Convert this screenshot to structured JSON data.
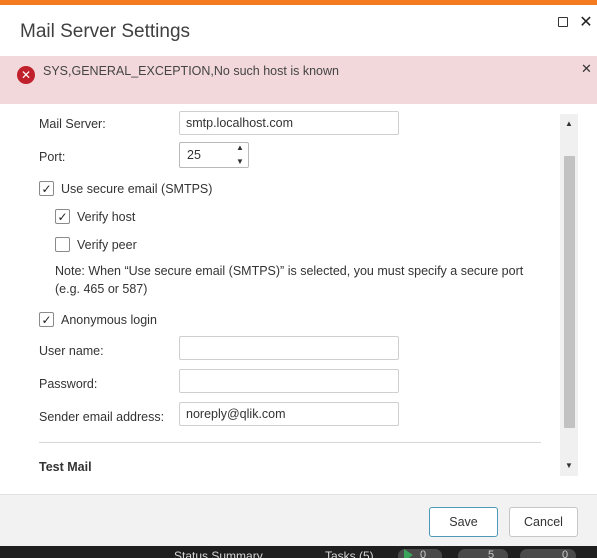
{
  "dialog": {
    "title": "Mail Server Settings"
  },
  "error": {
    "message": "SYS,GENERAL_EXCEPTION,No such host is known",
    "icon": "error-circle-icon",
    "color": "#c0202b",
    "background": "#f2d8da"
  },
  "form": {
    "mail_server": {
      "label": "Mail Server:",
      "value": "smtp.localhost.com"
    },
    "port": {
      "label": "Port:",
      "value": "25"
    },
    "use_secure": {
      "label": "Use secure email (SMTPS)",
      "checked": true
    },
    "verify_host": {
      "label": "Verify host",
      "checked": true
    },
    "verify_peer": {
      "label": "Verify peer",
      "checked": false
    },
    "note": "Note: When “Use secure email (SMTPS)” is selected, you must specify a secure port (e.g. 465 or 587)",
    "anonymous_login": {
      "label": "Anonymous login",
      "checked": true
    },
    "user_name": {
      "label": "User name:",
      "value": ""
    },
    "password": {
      "label": "Password:",
      "value": ""
    },
    "sender_email": {
      "label": "Sender email address:",
      "value": "noreply@qlik.com"
    }
  },
  "section": {
    "test_mail_title": "Test Mail"
  },
  "footer": {
    "save_label": "Save",
    "cancel_label": "Cancel"
  },
  "taskbar": {
    "status_summary": "Status Summary",
    "tasks": "Tasks (5)",
    "running_count": "0",
    "queued_count": "5",
    "other_count": "0"
  },
  "colors": {
    "accent": "#f47b20",
    "primary_button_border": "#4c9ab7"
  }
}
